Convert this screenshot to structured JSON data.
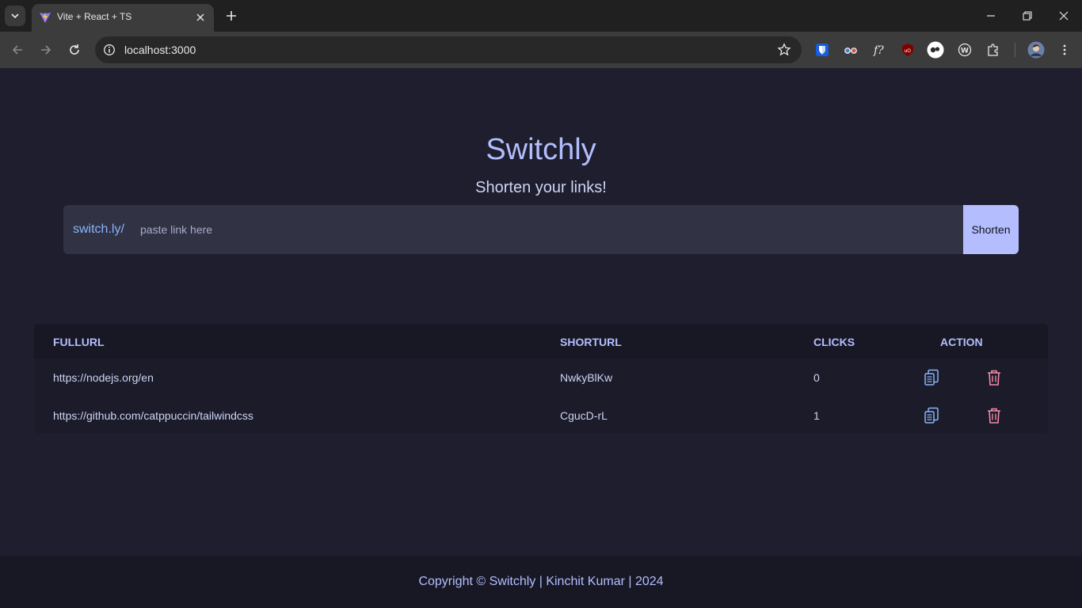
{
  "browser": {
    "tab_title": "Vite + React + TS",
    "url": "localhost:3000",
    "icons": {
      "tab_search": "chevron-down-icon",
      "favicon": "vite-logo-icon",
      "tab_close": "close-icon",
      "new_tab": "plus-icon",
      "back": "arrow-left-icon",
      "forward": "arrow-right-icon",
      "reload": "reload-icon",
      "site_info": "info-icon",
      "bookmark": "star-icon",
      "extensions": [
        "bitwarden-icon",
        "glasses-icon",
        "font-identifier-icon",
        "ublock-icon",
        "ghost-icon",
        "wappalyzer-icon",
        "puzzle-icon"
      ],
      "profile": "avatar-icon",
      "menu": "kebab-menu-icon",
      "window": [
        "minimize-icon",
        "restore-icon",
        "close-window-icon"
      ]
    }
  },
  "app": {
    "title": "Switchly",
    "subtitle": "Shorten your links!",
    "form": {
      "prefix": "switch.ly/",
      "placeholder": "paste link here",
      "button_label": "Shorten"
    },
    "table": {
      "headers": [
        "FULLURL",
        "SHORTURL",
        "CLICKS",
        "ACTION"
      ],
      "rows": [
        {
          "full": "https://nodejs.org/en",
          "short": "NwkyBlKw",
          "clicks": "0"
        },
        {
          "full": "https://github.com/catppuccin/tailwindcss",
          "short": "CgucD-rL",
          "clicks": "1"
        }
      ]
    },
    "footer": "Copyright © Switchly | Kinchit Kumar | 2024"
  },
  "colors": {
    "background": "#1e1e2e",
    "accent": "#b4befe",
    "copy_icon": "#89b4fa",
    "delete_icon": "#f38ba8"
  }
}
